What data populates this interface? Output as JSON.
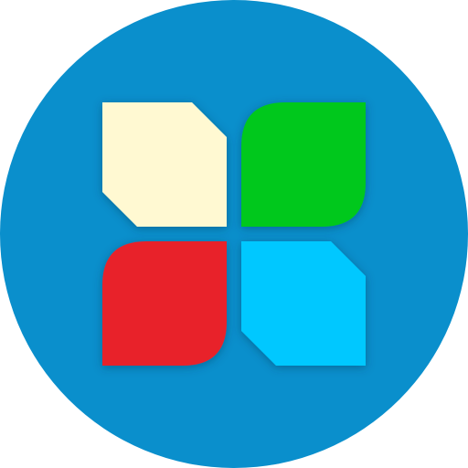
{
  "app_icon": {
    "icon_name": "four-tile-app-icon",
    "colors": {
      "background_circle": "#0a8fcc",
      "tile_cream": "#fff9d2",
      "tile_green": "#00c81a",
      "tile_red": "#e8232c",
      "tile_cyan": "#00c8ff"
    }
  }
}
